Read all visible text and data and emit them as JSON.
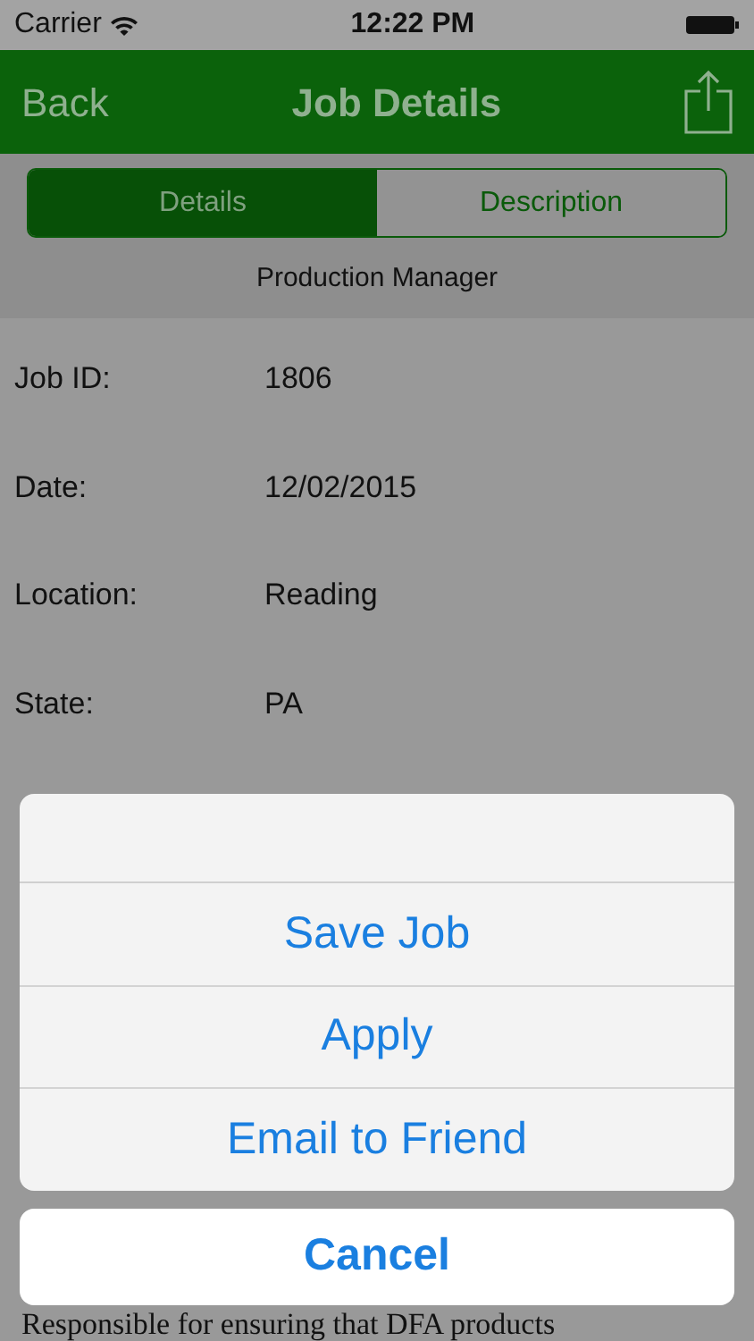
{
  "status_bar": {
    "carrier": "Carrier",
    "time": "12:22 PM"
  },
  "nav": {
    "back": "Back",
    "title": "Job Details"
  },
  "tabs": [
    {
      "label": "Details",
      "selected": true
    },
    {
      "label": "Description",
      "selected": false
    }
  ],
  "job_title": "Production Manager",
  "fields": [
    {
      "label": "Job ID:",
      "value": "1806"
    },
    {
      "label": "Date:",
      "value": "12/02/2015"
    },
    {
      "label": "Location:",
      "value": "Reading"
    },
    {
      "label": "State:",
      "value": "PA"
    }
  ],
  "description": "Responsible for ensuring that DFA products",
  "action_sheet": {
    "actions": [
      "Save Job",
      "Apply",
      "Email to Friend"
    ],
    "cancel": "Cancel"
  }
}
